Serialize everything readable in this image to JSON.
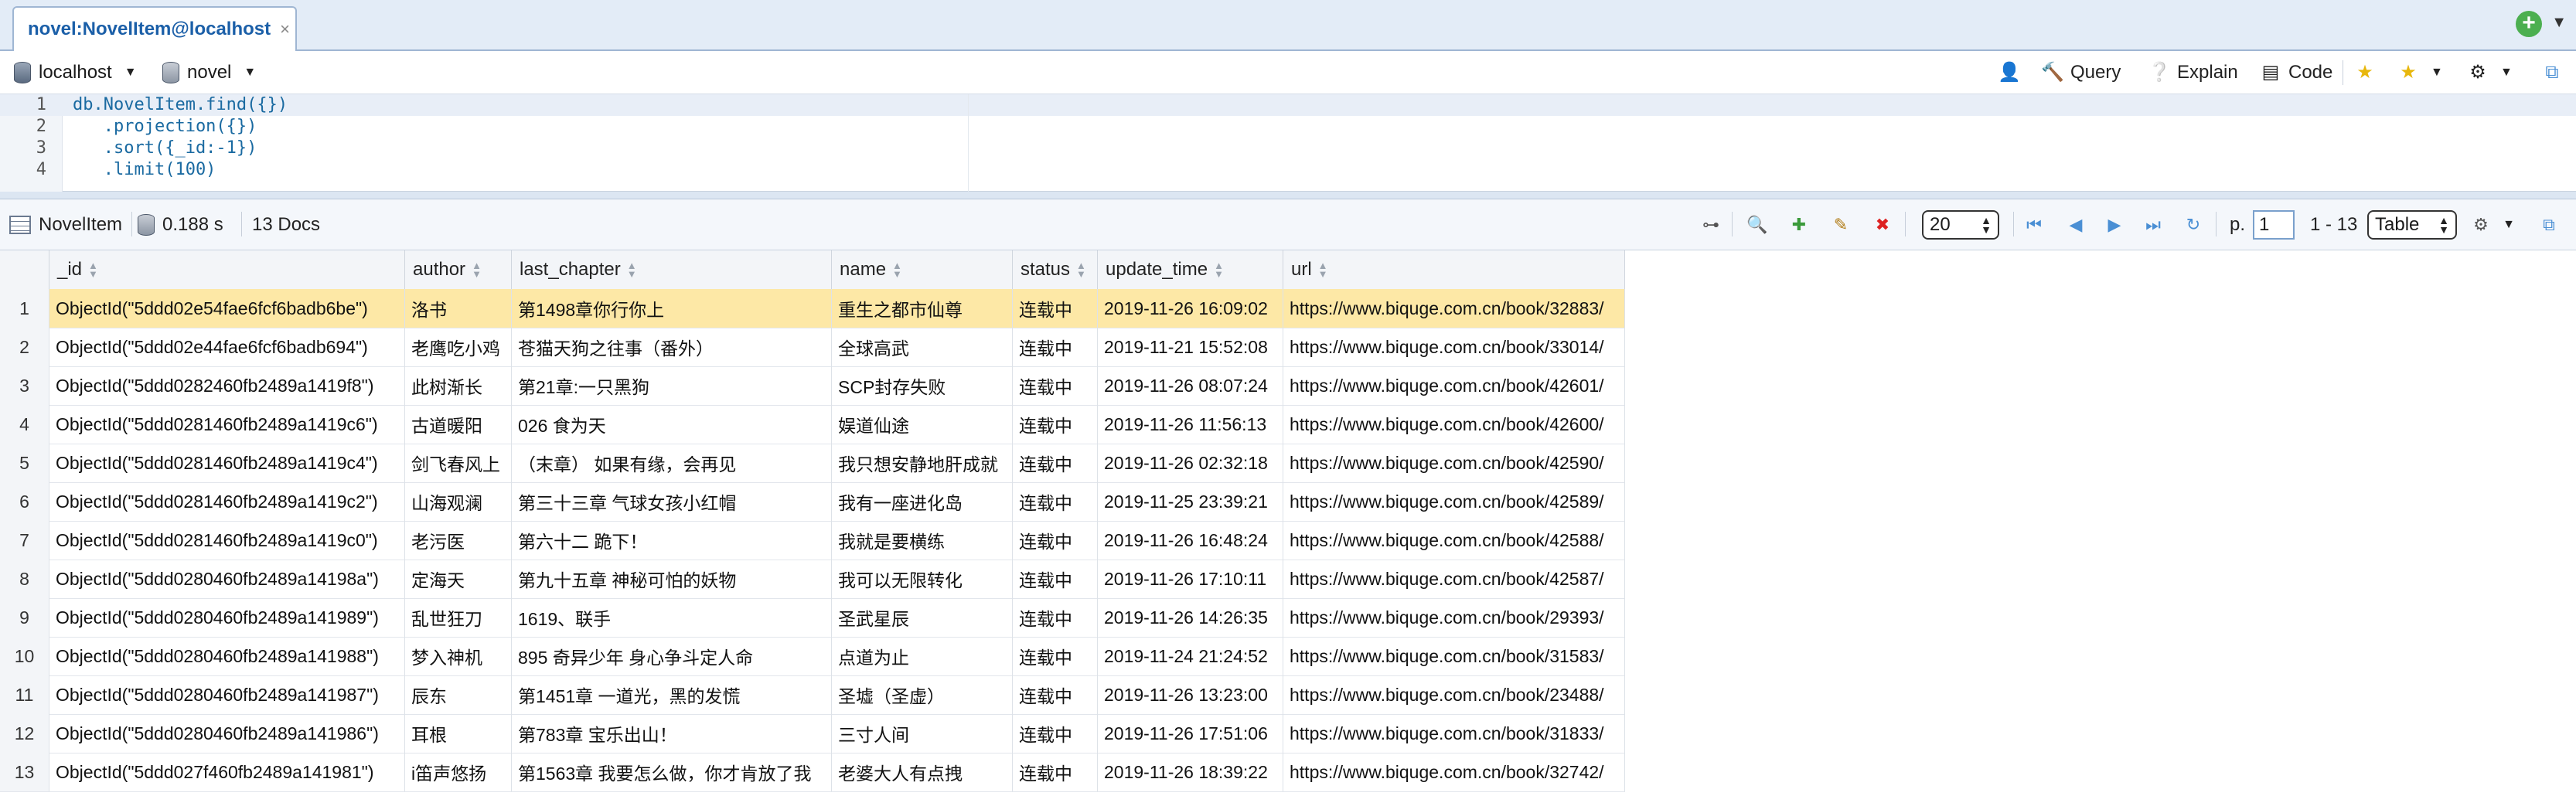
{
  "tab": {
    "title": "novel:NovelItem@localhost",
    "close": "×"
  },
  "connection": {
    "host": "localhost",
    "database": "novel"
  },
  "toolbar": {
    "query": "Query",
    "explain": "Explain",
    "code": "Code"
  },
  "editor": {
    "lines": [
      {
        "num": "1",
        "text": "db.NovelItem.find({})"
      },
      {
        "num": "2",
        "text": "   .projection({})"
      },
      {
        "num": "3",
        "text": "   .sort({_id:-1})"
      },
      {
        "num": "4",
        "text": "   .limit(100)"
      }
    ]
  },
  "results": {
    "collection": "NovelItem",
    "time": "0.188 s",
    "docs": "13 Docs",
    "page_size": "20",
    "page_label": "p.",
    "page": "1",
    "range": "1 - 13",
    "view_mode": "Table"
  },
  "columns": [
    "_id",
    "author",
    "last_chapter",
    "name",
    "status",
    "update_time",
    "url"
  ],
  "rows": [
    {
      "n": "1",
      "_id": "ObjectId(\"5ddd02e54fae6fcf6badb6be\")",
      "author": "洛书",
      "last_chapter": "第1498章你行你上",
      "name": "重生之都市仙尊",
      "status": "连载中",
      "update_time": "2019-11-26 16:09:02",
      "url": "https://www.biquge.com.cn/book/32883/"
    },
    {
      "n": "2",
      "_id": "ObjectId(\"5ddd02e44fae6fcf6badb694\")",
      "author": "老鹰吃小鸡",
      "last_chapter": "苍猫天狗之往事（番外）",
      "name": "全球高武",
      "status": "连载中",
      "update_time": "2019-11-21 15:52:08",
      "url": "https://www.biquge.com.cn/book/33014/"
    },
    {
      "n": "3",
      "_id": "ObjectId(\"5ddd0282460fb2489a1419f8\")",
      "author": "此树渐长",
      "last_chapter": "第21章:一只黑狗",
      "name": "SCP封存失败",
      "status": "连载中",
      "update_time": "2019-11-26 08:07:24",
      "url": "https://www.biquge.com.cn/book/42601/"
    },
    {
      "n": "4",
      "_id": "ObjectId(\"5ddd0281460fb2489a1419c6\")",
      "author": "古道暖阳",
      "last_chapter": "026 食为天",
      "name": "娱道仙途",
      "status": "连载中",
      "update_time": "2019-11-26 11:56:13",
      "url": "https://www.biquge.com.cn/book/42600/"
    },
    {
      "n": "5",
      "_id": "ObjectId(\"5ddd0281460fb2489a1419c4\")",
      "author": "剑飞春风上",
      "last_chapter": "（末章） 如果有缘，会再见",
      "name": "我只想安静地肝成就",
      "status": "连载中",
      "update_time": "2019-11-26 02:32:18",
      "url": "https://www.biquge.com.cn/book/42590/"
    },
    {
      "n": "6",
      "_id": "ObjectId(\"5ddd0281460fb2489a1419c2\")",
      "author": "山海观澜",
      "last_chapter": "第三十三章 气球女孩小红帽",
      "name": "我有一座进化岛",
      "status": "连载中",
      "update_time": "2019-11-25 23:39:21",
      "url": "https://www.biquge.com.cn/book/42589/"
    },
    {
      "n": "7",
      "_id": "ObjectId(\"5ddd0281460fb2489a1419c0\")",
      "author": "老污医",
      "last_chapter": "第六十二 跪下！",
      "name": "我就是要横练",
      "status": "连载中",
      "update_time": "2019-11-26 16:48:24",
      "url": "https://www.biquge.com.cn/book/42588/"
    },
    {
      "n": "8",
      "_id": "ObjectId(\"5ddd0280460fb2489a14198a\")",
      "author": "定海天",
      "last_chapter": "第九十五章 神秘可怕的妖物",
      "name": "我可以无限转化",
      "status": "连载中",
      "update_time": "2019-11-26 17:10:11",
      "url": "https://www.biquge.com.cn/book/42587/"
    },
    {
      "n": "9",
      "_id": "ObjectId(\"5ddd0280460fb2489a141989\")",
      "author": "乱世狂刀",
      "last_chapter": "1619、联手",
      "name": "圣武星辰",
      "status": "连载中",
      "update_time": "2019-11-26 14:26:35",
      "url": "https://www.biquge.com.cn/book/29393/"
    },
    {
      "n": "10",
      "_id": "ObjectId(\"5ddd0280460fb2489a141988\")",
      "author": "梦入神机",
      "last_chapter": "895 奇异少年 身心争斗定人命",
      "name": "点道为止",
      "status": "连载中",
      "update_time": "2019-11-24 21:24:52",
      "url": "https://www.biquge.com.cn/book/31583/"
    },
    {
      "n": "11",
      "_id": "ObjectId(\"5ddd0280460fb2489a141987\")",
      "author": "辰东",
      "last_chapter": "第1451章 一道光，黑的发慌",
      "name": "圣墟（圣虚）",
      "status": "连载中",
      "update_time": "2019-11-26 13:23:00",
      "url": "https://www.biquge.com.cn/book/23488/"
    },
    {
      "n": "12",
      "_id": "ObjectId(\"5ddd0280460fb2489a141986\")",
      "author": "耳根",
      "last_chapter": "第783章 宝乐出山！",
      "name": "三寸人间",
      "status": "连载中",
      "update_time": "2019-11-26 17:51:06",
      "url": "https://www.biquge.com.cn/book/31833/"
    },
    {
      "n": "13",
      "_id": "ObjectId(\"5ddd027f460fb2489a141981\")",
      "author": "i笛声悠扬",
      "last_chapter": "第1563章 我要怎么做，你才肯放了我",
      "name": "老婆大人有点拽",
      "status": "连载中",
      "update_time": "2019-11-26 18:39:22",
      "url": "https://www.biquge.com.cn/book/32742/"
    }
  ],
  "icons": [
    "database-icon",
    "collection-icon",
    "user-icon",
    "wand-icon",
    "explain-icon",
    "code-icon",
    "add-favorite-icon",
    "favorites-icon",
    "settings-icon",
    "maximize-icon",
    "tree-view-icon",
    "view-document-icon",
    "add-document-icon",
    "edit-document-icon",
    "delete-document-icon",
    "first-page-icon",
    "prev-page-icon",
    "next-page-icon",
    "last-page-icon",
    "refresh-icon",
    "gear-icon"
  ],
  "colors": {
    "accent": "#4a8fd4",
    "selected_row": "#fde8a6",
    "tab_text": "#1b5fa8",
    "add_button": "#4caf50"
  }
}
